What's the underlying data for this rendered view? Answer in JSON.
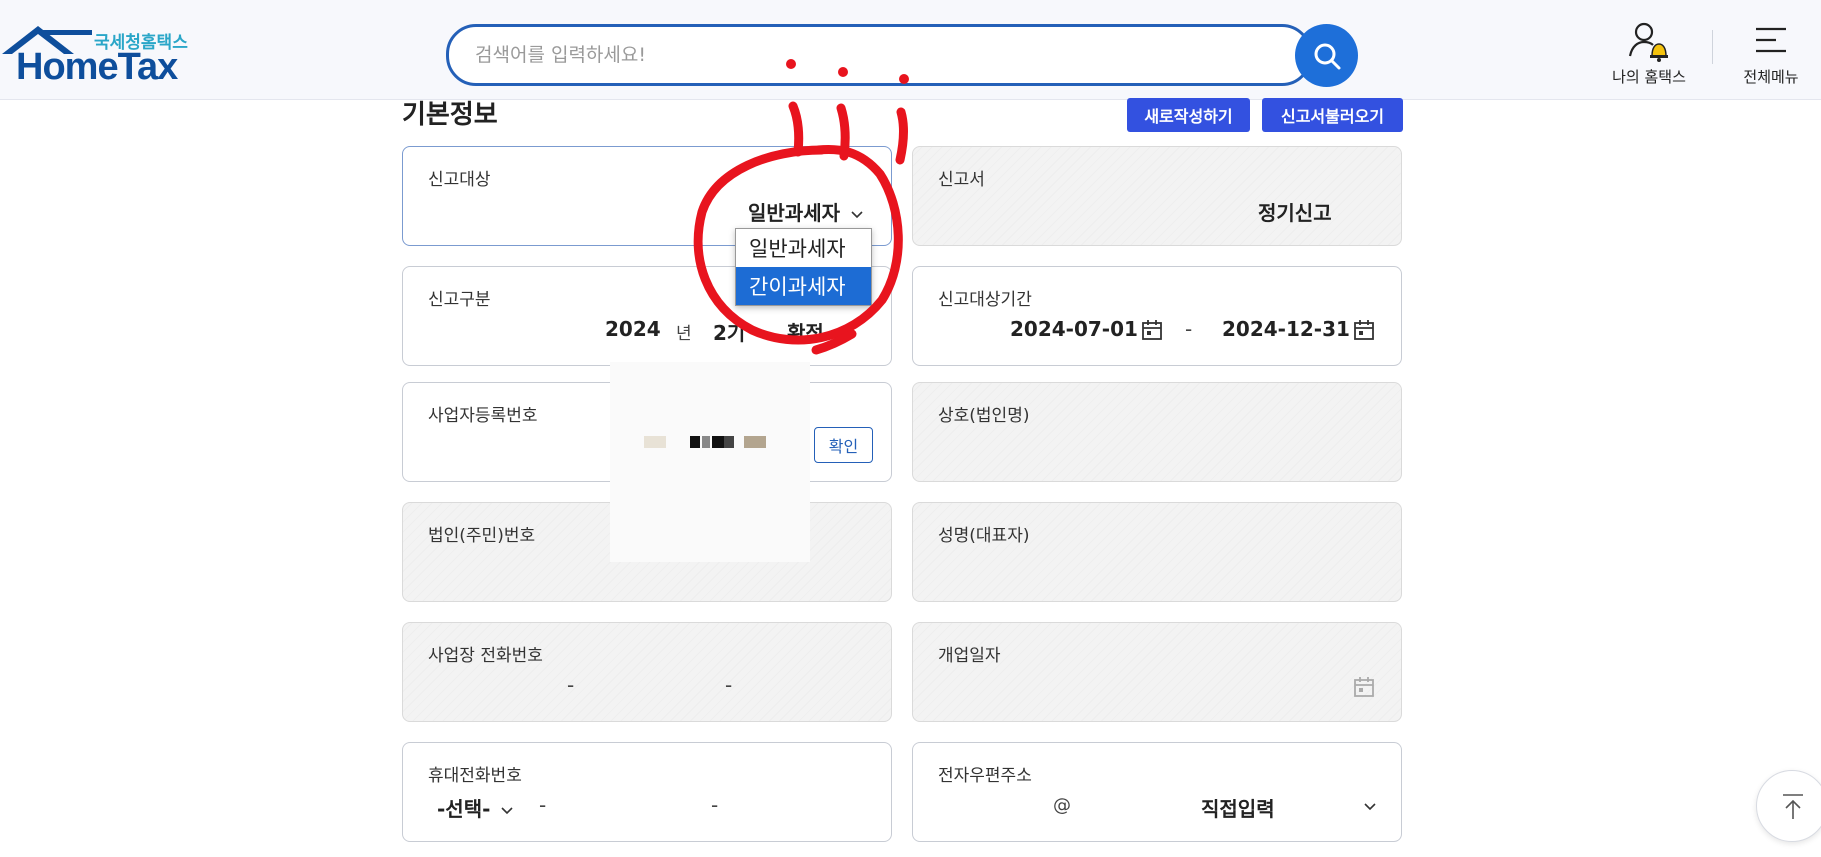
{
  "header": {
    "logo_sub": "국세청홈택스",
    "logo_main": "HomeTax",
    "search_placeholder": "검색어를 입력하세요!",
    "my_hometax_label": "나의 홈택스",
    "all_menu_label": "전체메뉴"
  },
  "section": {
    "title": "기본정보",
    "new_button": "새로작성하기",
    "load_button": "신고서불러오기"
  },
  "fields": {
    "target": {
      "label": "신고대상",
      "value": "일반과세자"
    },
    "target_options": [
      {
        "label": "일반과세자",
        "selected": false
      },
      {
        "label": "간이과세자",
        "selected": true
      }
    ],
    "report": {
      "label": "신고서",
      "value": "정기신고"
    },
    "category": {
      "label": "신고구분",
      "year": "2024",
      "year_unit": "년",
      "period": "2기",
      "type": "확정"
    },
    "period": {
      "label": "신고대상기간",
      "start": "2024-07-01",
      "sep": "-",
      "end": "2024-12-31"
    },
    "brn": {
      "label": "사업자등록번호",
      "confirm": "확인"
    },
    "company": {
      "label": "상호(법인명)"
    },
    "corp_id": {
      "label": "법인(주민)번호"
    },
    "rep_name": {
      "label": "성명(대표자)"
    },
    "biz_phone": {
      "label": "사업장 전화번호",
      "sep1": "-",
      "sep2": "-"
    },
    "open_date": {
      "label": "개업일자"
    },
    "mobile": {
      "label": "휴대전화번호",
      "select": "-선택-",
      "sep1": "-",
      "sep2": "-"
    },
    "email": {
      "label": "전자우편주소",
      "at": "@",
      "domain_select": "직접입력"
    }
  },
  "colors": {
    "accent": "#3351e0",
    "header_bg": "#f7f8fc",
    "search_border": "#2460b8",
    "dropdown_selected": "#1d6cd4",
    "annotation": "#e8141e"
  },
  "icons": [
    "search-icon",
    "user-bell-icon",
    "hamburger-icon",
    "calendar-icon",
    "chevron-down-icon",
    "arrow-up-icon"
  ]
}
